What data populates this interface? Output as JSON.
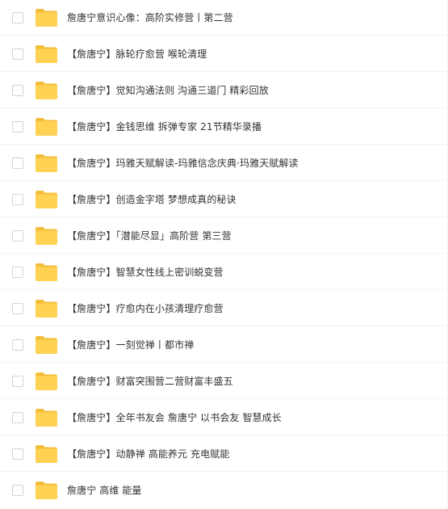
{
  "folder_color": "#FFD253",
  "folder_tab_color": "#F5BE3A",
  "items": [
    {
      "name": "詹唐宁意识心像：高阶实修营丨第二营",
      "icon": "folder-icon"
    },
    {
      "name": "【詹唐宁】脉轮疗愈营 喉轮清理",
      "icon": "folder-icon"
    },
    {
      "name": "【詹唐宁】觉知沟通法则 沟通三道门 精彩回放",
      "icon": "folder-icon"
    },
    {
      "name": "【詹唐宁】金钱思维 拆弹专家 21节精华录播",
      "icon": "folder-icon"
    },
    {
      "name": "【詹唐宁】玛雅天赋解读-玛雅信念庆典·玛雅天赋解读",
      "icon": "folder-icon"
    },
    {
      "name": "【詹唐宁】创造金字塔 梦想成真的秘诀",
      "icon": "folder-icon"
    },
    {
      "name": "【詹唐宁】「潜能尽显」高阶营 第三营",
      "icon": "folder-icon"
    },
    {
      "name": "【詹唐宁】智慧女性线上密训蜕变营",
      "icon": "folder-icon"
    },
    {
      "name": "【詹唐宁】疗愈内在小孩清理疗愈营",
      "icon": "folder-icon"
    },
    {
      "name": "【詹唐宁】一刻觉禅丨都市禅",
      "icon": "folder-icon"
    },
    {
      "name": "【詹唐宁】财富突围营二营财富丰盛五",
      "icon": "folder-icon"
    },
    {
      "name": "【詹唐宁】全年书友会 詹唐宁 以书会友 智慧成长",
      "icon": "folder-icon"
    },
    {
      "name": "【詹唐宁】动静禅 高能养元 充电赋能",
      "icon": "folder-icon"
    },
    {
      "name": "詹唐宁 高维 能量",
      "icon": "folder-icon"
    }
  ]
}
